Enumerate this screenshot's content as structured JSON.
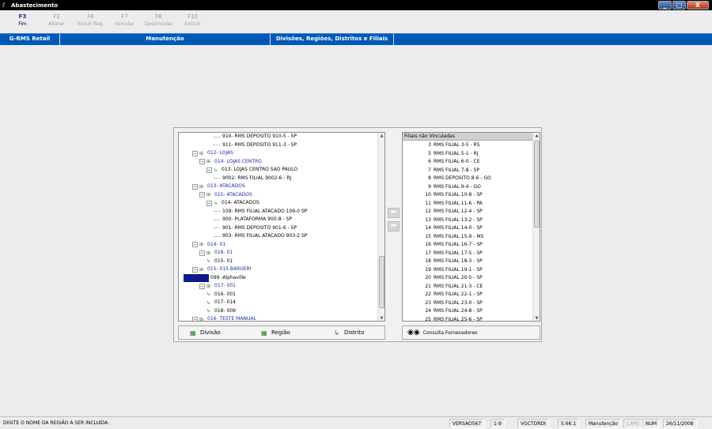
{
  "window": {
    "title": "Abastecimento",
    "controls": {
      "minimize": "_",
      "maximize": "□",
      "close": "X"
    }
  },
  "toolbar": [
    {
      "key": "F3",
      "label": "Fim",
      "enabled": true
    },
    {
      "key": "F2",
      "label": "Alterar",
      "enabled": false
    },
    {
      "key": "F6",
      "label": "Incluir Reg.",
      "enabled": false
    },
    {
      "key": "F7",
      "label": "Vincular",
      "enabled": false
    },
    {
      "key": "F8",
      "label": "Desvincular",
      "enabled": false
    },
    {
      "key": "F10",
      "label": "Excluir",
      "enabled": false
    }
  ],
  "nav": {
    "app": "G-RMS Retail",
    "module": "Manutenção",
    "screen": "Divisões, Regiões, Distritos e Filiais"
  },
  "tree": [
    {
      "indent": 4,
      "text": "910- RMS DEPOSITO 910-5 - SP",
      "kind": "leaf"
    },
    {
      "indent": 4,
      "text": "911- RMS DEPOSITO 911-3 - SP",
      "kind": "leaf"
    },
    {
      "indent": 1,
      "text": "012- LOJAS",
      "kind": "group"
    },
    {
      "indent": 2,
      "text": "014- LOJAS CENTRO",
      "kind": "group"
    },
    {
      "indent": 3,
      "text": "013- LOJAS CENTRO SAO PAULO",
      "kind": "district"
    },
    {
      "indent": 4,
      "text": "9002- RMS FILIAL 9002-6 - RJ",
      "kind": "leaf"
    },
    {
      "indent": 1,
      "text": "013- ATACADOS",
      "kind": "group"
    },
    {
      "indent": 2,
      "text": "015- ATACADOS",
      "kind": "group"
    },
    {
      "indent": 3,
      "text": "014- ATACADOS",
      "kind": "district"
    },
    {
      "indent": 4,
      "text": "109- RMS FILIAL ATACADO 109-0 SP",
      "kind": "leaf"
    },
    {
      "indent": 4,
      "text": "900- PLATAFORMA 900-8 - SP",
      "kind": "leaf"
    },
    {
      "indent": 4,
      "text": "901- RMS DEPOSITO 901-6 - SP",
      "kind": "leaf"
    },
    {
      "indent": 4,
      "text": "903- RMS FILIAL ATACADO 903-2 SP",
      "kind": "leaf"
    },
    {
      "indent": 1,
      "text": "014- 01",
      "kind": "group"
    },
    {
      "indent": 2,
      "text": "016- 01",
      "kind": "group"
    },
    {
      "indent": 3,
      "text": "015- 01",
      "kind": "districtleaf"
    },
    {
      "indent": 1,
      "text": "015- 015 BARUERI",
      "kind": "group"
    },
    {
      "indent": 2,
      "text": "099 -Alphaville",
      "kind": "selected"
    },
    {
      "indent": 2,
      "text": "017- 001",
      "kind": "group"
    },
    {
      "indent": 3,
      "text": "016- 001",
      "kind": "districtleaf"
    },
    {
      "indent": 3,
      "text": "017- 014",
      "kind": "districtleaf"
    },
    {
      "indent": 3,
      "text": "018- 009",
      "kind": "districtleaf"
    },
    {
      "indent": 1,
      "text": "016- TESTE MANUAL",
      "kind": "group"
    }
  ],
  "unlinked": {
    "header": "Filiais não Vinculadas",
    "items": [
      {
        "num": "3",
        "name": "RMS FILIAL 3-5 - RS"
      },
      {
        "num": "5",
        "name": "RMS FILIAL 5-1 - RJ"
      },
      {
        "num": "6",
        "name": "RMS FILIAL 6-0 - CE"
      },
      {
        "num": "7",
        "name": "RMS FILIAL 7-8 - SP"
      },
      {
        "num": "8",
        "name": "RMS DEPOSITO 8-6 - GO"
      },
      {
        "num": "9",
        "name": "RMS FILIAL 9-4 - GO"
      },
      {
        "num": "10",
        "name": "RMS FILIAL 10-8 - SP"
      },
      {
        "num": "11",
        "name": "RMS FILIAL 11-6 - PA"
      },
      {
        "num": "12",
        "name": "RMS FILIAL 12-4 - SP"
      },
      {
        "num": "13",
        "name": "RMS FILIAL 13-2 - SP"
      },
      {
        "num": "14",
        "name": "RMS FILIAL 14-0 - SP"
      },
      {
        "num": "15",
        "name": "RMS FILIAL 15-9 - MS"
      },
      {
        "num": "16",
        "name": "RMS FILIAL 16-7 - SP"
      },
      {
        "num": "17",
        "name": "RMS FILIAL 17-5 - SP"
      },
      {
        "num": "18",
        "name": "RMS FILIAL 18-3 - SP"
      },
      {
        "num": "19",
        "name": "RMS FILIAL 19-1 - SP"
      },
      {
        "num": "20",
        "name": "RMS FILIAL 20-5 - SP"
      },
      {
        "num": "21",
        "name": "RMS FILIAL 21-3 - CE"
      },
      {
        "num": "22",
        "name": "RMS FILIAL 22-1 - SP"
      },
      {
        "num": "23",
        "name": "RMS FILIAL 23-0 - SP"
      },
      {
        "num": "24",
        "name": "RMS FILIAL 24-8 - SP"
      },
      {
        "num": "25",
        "name": "RMS FILIAL 25-6 - SP"
      }
    ]
  },
  "buttons": {
    "division": "Divisão",
    "region": "Região",
    "district": "Distrito",
    "consult": "Consulta Fornecedores"
  },
  "status": {
    "message": "DIGITE O NOME DA REGIÃO A SER INCLUÍDA.",
    "version": "VERSAO567",
    "range": "1-9",
    "user": "VGCTDRDI",
    "build": "5.66.1",
    "mode": "Manutenção",
    "caps": "CAPS",
    "num": "NUM",
    "date": "26/11/2008"
  }
}
